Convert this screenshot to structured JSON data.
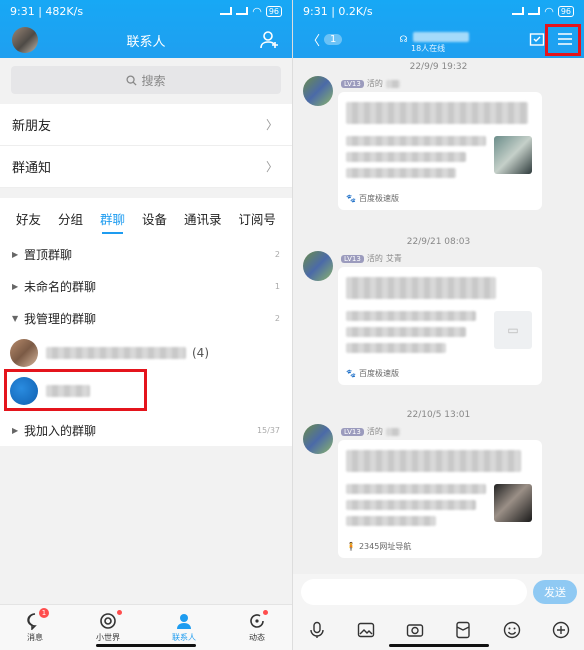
{
  "left": {
    "status": {
      "time": "9:31 | 482K/s",
      "battery": "96"
    },
    "nav": {
      "title": "联系人"
    },
    "search": {
      "placeholder": "搜索"
    },
    "rows": [
      {
        "label": "新朋友"
      },
      {
        "label": "群通知"
      }
    ],
    "tabs": [
      "好友",
      "分组",
      "群聊",
      "设备",
      "通讯录",
      "订阅号"
    ],
    "active_tab": "群聊",
    "groups": [
      {
        "label": "置顶群聊",
        "count": "2",
        "expanded": false
      },
      {
        "label": "未命名的群聊",
        "count": "1",
        "expanded": false
      },
      {
        "label": "我管理的群聊",
        "count": "2",
        "expanded": true
      }
    ],
    "managed_items": [
      {
        "suffix": "(4)"
      },
      {
        "suffix": ""
      }
    ],
    "joined": {
      "label": "我加入的群聊",
      "count": "15/37"
    },
    "bottom_nav": [
      {
        "label": "消息",
        "badge": "1",
        "icon": "message-icon"
      },
      {
        "label": "小世界",
        "badge": "",
        "icon": "world-icon"
      },
      {
        "label": "联系人",
        "badge": "",
        "icon": "contacts-icon"
      },
      {
        "label": "动态",
        "badge": "",
        "icon": "feed-icon"
      }
    ]
  },
  "right": {
    "status": {
      "time": "9:31 | 0.2K/s",
      "battery": "96"
    },
    "nav": {
      "unread": "1",
      "subtitle": "18人在线"
    },
    "messages": [
      {
        "time": "22/9/9 19:32",
        "level": "LV13",
        "title": "活的",
        "name": "",
        "source": "百度极速版"
      },
      {
        "time": "22/9/21 08:03",
        "level": "LV13",
        "title": "活的",
        "name": "艾青",
        "source": "百度极速版"
      },
      {
        "time": "22/10/5 13:01",
        "level": "LV13",
        "title": "活的",
        "name": "",
        "source": "2345网址导航"
      }
    ],
    "input": {
      "send_label": "发送"
    },
    "highlight_color": "#e4141c",
    "accent": "#1e9cf0"
  }
}
